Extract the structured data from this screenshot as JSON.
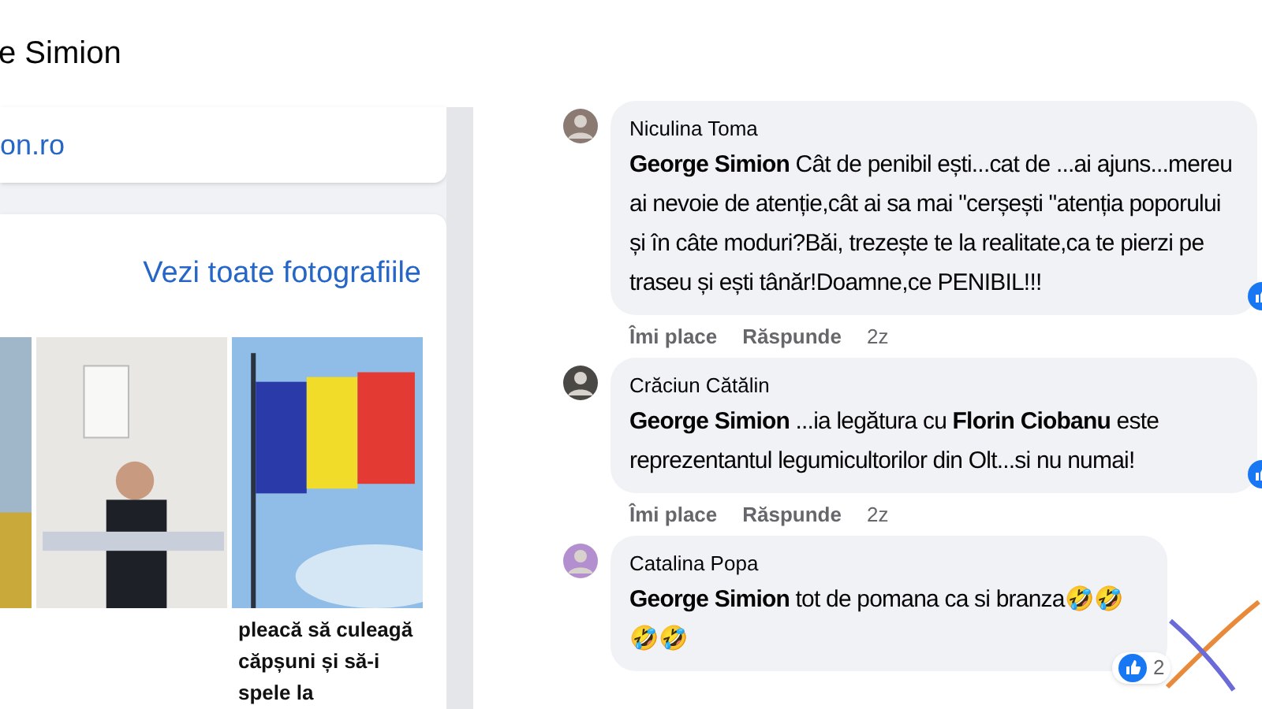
{
  "header": {
    "title": "e Simion"
  },
  "intro_card": {
    "link": "on.ro"
  },
  "photos_card": {
    "see_all": "Vezi toate fotografiile",
    "tiles": [
      {
        "kind": "picture"
      },
      {
        "kind": "picture"
      },
      {
        "kind": "picture",
        "caption": "pleacă să culeagă căpșuni și să-i spele la"
      }
    ]
  },
  "comments": [
    {
      "author": "Niculina Toma",
      "text": "**George Simion** Cât de penibil ești...cat de ...ai ajuns...mereu ai nevoie de atenție,cât ai sa mai \"cerșești \"atenția poporului și în câte moduri?Băi, trezește te la realitate,ca te pierzi pe traseu și ești tânăr!Doamne,ce PENIBIL!!!",
      "actions": [
        "Îmi place",
        "Răspunde"
      ],
      "time": "2z"
    },
    {
      "author": "Crăciun Cătălin",
      "text": "**George Simion** ...ia legătura cu **Florin Ciobanu** este reprezentantul legumicultorilor din Olt...si nu numai!",
      "actions": [
        "Îmi place",
        "Răspunde"
      ],
      "time": "2z"
    },
    {
      "author": "Catalina Popa",
      "text": "**George Simion** tot de pomana ca si branza🤣🤣🤣🤣",
      "reaction_count": "2"
    }
  ]
}
